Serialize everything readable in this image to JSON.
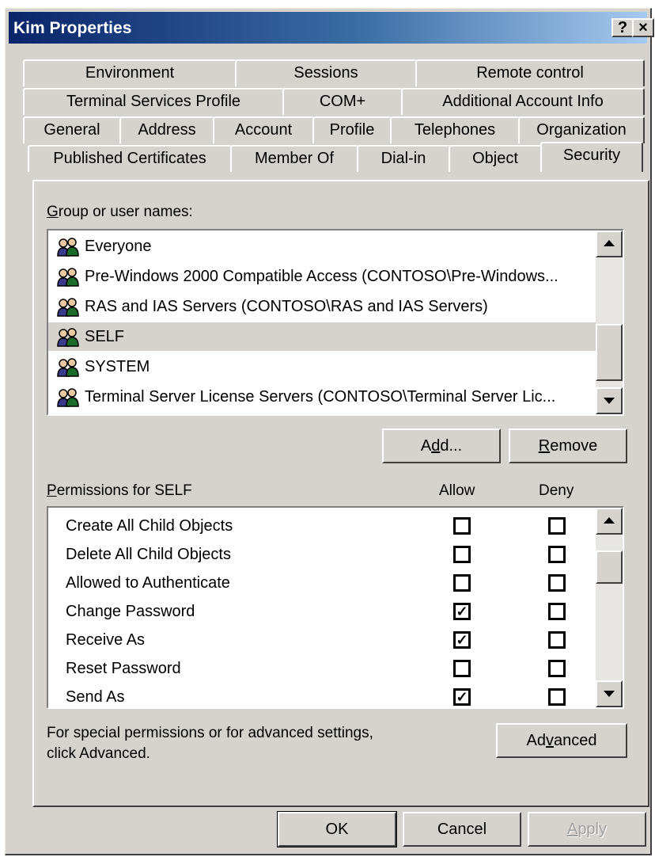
{
  "window": {
    "title": "Kim Properties",
    "help_glyph": "?",
    "close_glyph": "×"
  },
  "tabs": {
    "row1": [
      "Environment",
      "Sessions",
      "Remote control"
    ],
    "row2": [
      "Terminal Services Profile",
      "COM+",
      "Additional Account Info"
    ],
    "row3": [
      "General",
      "Address",
      "Account",
      "Profile",
      "Telephones",
      "Organization"
    ],
    "row4": [
      "Published Certificates",
      "Member Of",
      "Dial-in",
      "Object",
      "Security"
    ],
    "active": "Security"
  },
  "groups": {
    "label": "Group or user names:",
    "items": [
      {
        "name": "Everyone",
        "selected": false
      },
      {
        "name": "Pre-Windows 2000 Compatible Access (CONTOSO\\Pre-Windows...",
        "selected": false
      },
      {
        "name": "RAS and IAS Servers (CONTOSO\\RAS and IAS Servers)",
        "selected": false
      },
      {
        "name": "SELF",
        "selected": true
      },
      {
        "name": "SYSTEM",
        "selected": false
      },
      {
        "name": "Terminal Server License Servers (CONTOSO\\Terminal Server Lic...",
        "selected": false
      }
    ],
    "icon": "group-users-icon"
  },
  "buttons": {
    "add": "Add...",
    "remove": "Remove",
    "advanced": "Advanced",
    "ok": "OK",
    "cancel": "Cancel",
    "apply": "Apply"
  },
  "permissions": {
    "label": "Permissions for SELF",
    "allow_header": "Allow",
    "deny_header": "Deny",
    "items": [
      {
        "name": "Create All Child Objects",
        "allow": false,
        "deny": false
      },
      {
        "name": "Delete All Child Objects",
        "allow": false,
        "deny": false
      },
      {
        "name": "Allowed to Authenticate",
        "allow": false,
        "deny": false
      },
      {
        "name": "Change Password",
        "allow": true,
        "deny": false
      },
      {
        "name": "Receive As",
        "allow": true,
        "deny": false
      },
      {
        "name": "Reset Password",
        "allow": false,
        "deny": false
      },
      {
        "name": "Send As",
        "allow": true,
        "deny": false
      }
    ]
  },
  "advanced_text": {
    "line1": "For special permissions or for advanced settings,",
    "line2": "click Advanced."
  }
}
